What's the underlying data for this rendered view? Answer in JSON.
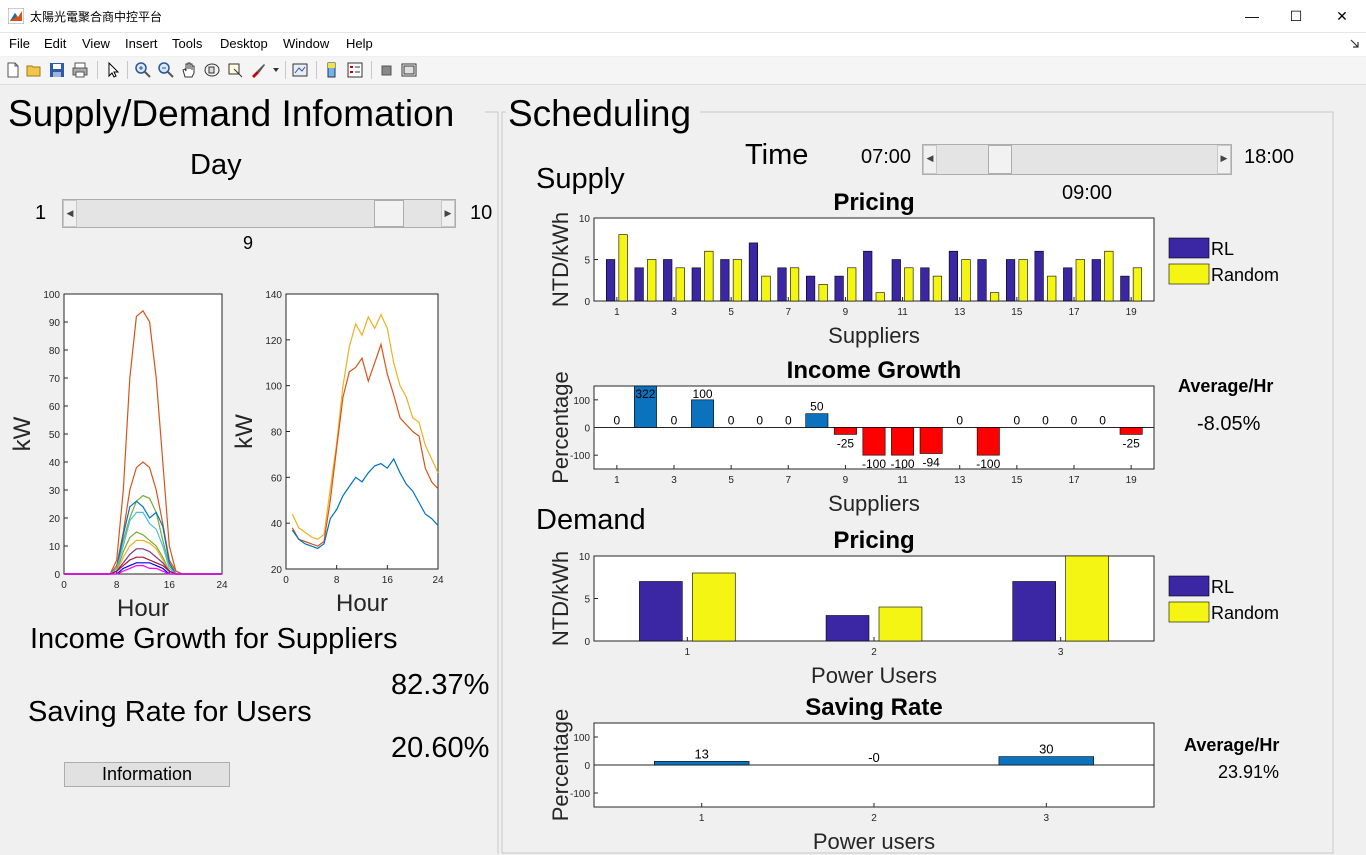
{
  "window": {
    "title": "太陽光電聚合商中控平台",
    "minimize": "—",
    "maximize": "☐",
    "close": "✕"
  },
  "menu": [
    "File",
    "Edit",
    "View",
    "Insert",
    "Tools",
    "Desktop",
    "Window",
    "Help"
  ],
  "left": {
    "title": "Supply/Demand Infomation",
    "day_label": "Day",
    "day_min": "1",
    "day_max": "10",
    "day_value": "9",
    "day_fraction": 0.89,
    "income_growth_label": "Income Growth for Suppliers",
    "income_growth_value": "82.37%",
    "saving_rate_label": "Saving Rate for Users",
    "saving_rate_value": "20.60%",
    "info_button": "Information"
  },
  "right": {
    "title": "Scheduling",
    "time_label": "Time",
    "time_min": "07:00",
    "time_max": "18:00",
    "time_value": "09:00",
    "time_fraction": 0.2,
    "supply_label": "Supply",
    "demand_label": "Demand",
    "avg_label": "Average/Hr",
    "income_avg": "-8.05%",
    "saving_avg": "23.91%"
  },
  "colors": {
    "rl": "#3b27a3",
    "random": "#f5f514",
    "pos_bar": "#0b72bd",
    "neg_bar": "#ff0000"
  },
  "chart_data": [
    {
      "type": "line",
      "title": "",
      "xlabel": "Hour",
      "ylabel": "kW",
      "xlim": [
        0,
        24
      ],
      "ylim": [
        0,
        100
      ],
      "xticks": [
        0,
        8,
        16,
        24
      ],
      "yticks": [
        0,
        10,
        20,
        30,
        40,
        50,
        60,
        70,
        80,
        90,
        100
      ],
      "x": [
        0,
        1,
        2,
        3,
        4,
        5,
        6,
        7,
        8,
        9,
        10,
        11,
        12,
        13,
        14,
        15,
        16,
        17,
        18,
        19,
        20,
        21,
        22,
        23,
        24
      ],
      "series": [
        {
          "color": "#d95319",
          "values": [
            0,
            0,
            0,
            0,
            0,
            0,
            0,
            0,
            5,
            30,
            70,
            92,
            94,
            90,
            70,
            40,
            10,
            1,
            0,
            0,
            0,
            0,
            0,
            0,
            0
          ]
        },
        {
          "color": "#d95319",
          "values": [
            0,
            0,
            0,
            0,
            0,
            0,
            0,
            0,
            3,
            15,
            30,
            38,
            40,
            38,
            30,
            18,
            5,
            1,
            0,
            0,
            0,
            0,
            0,
            0,
            0
          ]
        },
        {
          "color": "#77ac30",
          "values": [
            0,
            0,
            0,
            0,
            0,
            0,
            0,
            0,
            2,
            12,
            20,
            26,
            28,
            27,
            22,
            12,
            3,
            0,
            0,
            0,
            0,
            0,
            0,
            0,
            0
          ]
        },
        {
          "color": "#0072bd",
          "values": [
            0,
            0,
            0,
            0,
            0,
            0,
            0,
            0,
            2,
            14,
            24,
            26,
            24,
            20,
            22,
            17,
            4,
            0,
            0,
            0,
            0,
            0,
            0,
            0,
            0
          ]
        },
        {
          "color": "#4dbeee",
          "values": [
            0,
            0,
            0,
            0,
            0,
            0,
            0,
            0,
            2,
            10,
            19,
            22,
            22,
            18,
            16,
            10,
            2,
            0,
            0,
            0,
            0,
            0,
            0,
            0,
            0
          ]
        },
        {
          "color": "#77ac30",
          "values": [
            0,
            0,
            0,
            0,
            0,
            0,
            0,
            0,
            1,
            8,
            13,
            15,
            14,
            12,
            10,
            6,
            1,
            0,
            0,
            0,
            0,
            0,
            0,
            0,
            0
          ]
        },
        {
          "color": "#edb120",
          "values": [
            0,
            0,
            0,
            0,
            0,
            0,
            0,
            0,
            1,
            6,
            10,
            12,
            12,
            11,
            9,
            5,
            1,
            0,
            0,
            0,
            0,
            0,
            0,
            0,
            0
          ]
        },
        {
          "color": "#7e2f8e",
          "values": [
            0,
            0,
            0,
            0,
            0,
            0,
            0,
            0,
            1,
            4,
            7,
            9,
            9,
            8,
            6,
            4,
            1,
            0,
            0,
            0,
            0,
            0,
            0,
            0,
            0
          ]
        },
        {
          "color": "#a2142f",
          "values": [
            0,
            0,
            0,
            0,
            0,
            0,
            0,
            0,
            1,
            3,
            5,
            6,
            6,
            5,
            4,
            3,
            1,
            0,
            0,
            0,
            0,
            0,
            0,
            0,
            0
          ]
        },
        {
          "color": "#0000ff",
          "values": [
            0,
            0,
            0,
            0,
            0,
            0,
            0,
            0,
            0,
            2,
            3,
            4,
            4,
            4,
            3,
            2,
            0,
            0,
            0,
            0,
            0,
            0,
            0,
            0,
            0
          ]
        },
        {
          "color": "#ff00ff",
          "values": [
            0,
            0,
            0,
            0,
            0,
            0,
            0,
            0,
            0,
            1,
            2,
            3,
            3,
            2,
            2,
            1,
            0,
            0,
            0,
            0,
            0,
            0,
            0,
            0,
            0
          ]
        }
      ]
    },
    {
      "type": "line",
      "title": "",
      "xlabel": "Hour",
      "ylabel": "kW",
      "xlim": [
        0,
        24
      ],
      "ylim": [
        20,
        140
      ],
      "xticks": [
        0,
        8,
        16,
        24
      ],
      "yticks": [
        20,
        40,
        60,
        80,
        100,
        120,
        140
      ],
      "x": [
        1,
        2,
        3,
        4,
        5,
        6,
        7,
        8,
        9,
        10,
        11,
        12,
        13,
        14,
        15,
        16,
        17,
        18,
        19,
        20,
        21,
        22,
        23,
        24
      ],
      "series": [
        {
          "color": "#edb120",
          "values": [
            44,
            38,
            36,
            34,
            33,
            35,
            55,
            75,
            100,
            117,
            127,
            122,
            130,
            125,
            131,
            125,
            110,
            100,
            95,
            86,
            84,
            74,
            68,
            62
          ]
        },
        {
          "color": "#d95319",
          "values": [
            38,
            33,
            32,
            31,
            30,
            32,
            50,
            73,
            95,
            106,
            108,
            112,
            102,
            110,
            118,
            105,
            96,
            86,
            83,
            80,
            78,
            64,
            58,
            55
          ]
        },
        {
          "color": "#0072bd",
          "values": [
            37,
            33,
            31,
            30,
            29,
            31,
            42,
            46,
            52,
            56,
            60,
            58,
            62,
            65,
            66,
            64,
            68,
            62,
            57,
            54,
            49,
            44,
            42,
            39
          ]
        }
      ]
    },
    {
      "type": "bar",
      "title": "Pricing",
      "xlabel": "Suppliers",
      "ylabel": "NTD/kWh",
      "ylim": [
        0,
        10
      ],
      "yticks": [
        0,
        5,
        10
      ],
      "categories": [
        "1",
        "2",
        "3",
        "4",
        "5",
        "6",
        "7",
        "8",
        "9",
        "10",
        "11",
        "12",
        "13",
        "14",
        "15",
        "16",
        "17",
        "18",
        "19"
      ],
      "xticks": [
        "1",
        "3",
        "5",
        "7",
        "9",
        "11",
        "13",
        "15",
        "17",
        "19"
      ],
      "legend": "right",
      "series": [
        {
          "name": "RL",
          "values": [
            5,
            4,
            5,
            4,
            5,
            7,
            4,
            3,
            3,
            6,
            5,
            4,
            6,
            5,
            5,
            6,
            4,
            5,
            3
          ]
        },
        {
          "name": "Random",
          "values": [
            8,
            5,
            4,
            6,
            5,
            3,
            4,
            2,
            4,
            1,
            4,
            3,
            5,
            1,
            5,
            3,
            5,
            6,
            4
          ]
        }
      ]
    },
    {
      "type": "bar",
      "title": "Income Growth",
      "xlabel": "Suppliers",
      "ylabel": "Percentage",
      "ylim": [
        -150,
        150
      ],
      "yticks": [
        -100,
        0,
        100
      ],
      "categories": [
        "1",
        "2",
        "3",
        "4",
        "5",
        "6",
        "7",
        "8",
        "9",
        "10",
        "11",
        "12",
        "13",
        "14",
        "15",
        "16",
        "17",
        "18",
        "19"
      ],
      "xticks": [
        "1",
        "3",
        "5",
        "7",
        "9",
        "11",
        "13",
        "15",
        "17",
        "19"
      ],
      "values": [
        0,
        322,
        0,
        100,
        0,
        0,
        0,
        50,
        -25,
        -100,
        -100,
        -94,
        0,
        -100,
        0,
        0,
        0,
        0,
        -25
      ]
    },
    {
      "type": "bar",
      "title": "Pricing",
      "xlabel": "Power Users",
      "ylabel": "NTD/kWh",
      "ylim": [
        0,
        10
      ],
      "yticks": [
        0,
        5,
        10
      ],
      "categories": [
        "1",
        "2",
        "3"
      ],
      "legend": "right",
      "series": [
        {
          "name": "RL",
          "values": [
            7,
            3,
            7
          ]
        },
        {
          "name": "Random",
          "values": [
            8,
            4,
            10
          ]
        }
      ]
    },
    {
      "type": "bar",
      "title": "Saving Rate",
      "xlabel": "Power users",
      "ylabel": "Percentage",
      "ylim": [
        -150,
        150
      ],
      "yticks": [
        -100,
        0,
        100
      ],
      "categories": [
        "1",
        "2",
        "3"
      ],
      "values": [
        13,
        0,
        30
      ],
      "value_labels": [
        "13",
        "-0",
        "30"
      ]
    }
  ]
}
